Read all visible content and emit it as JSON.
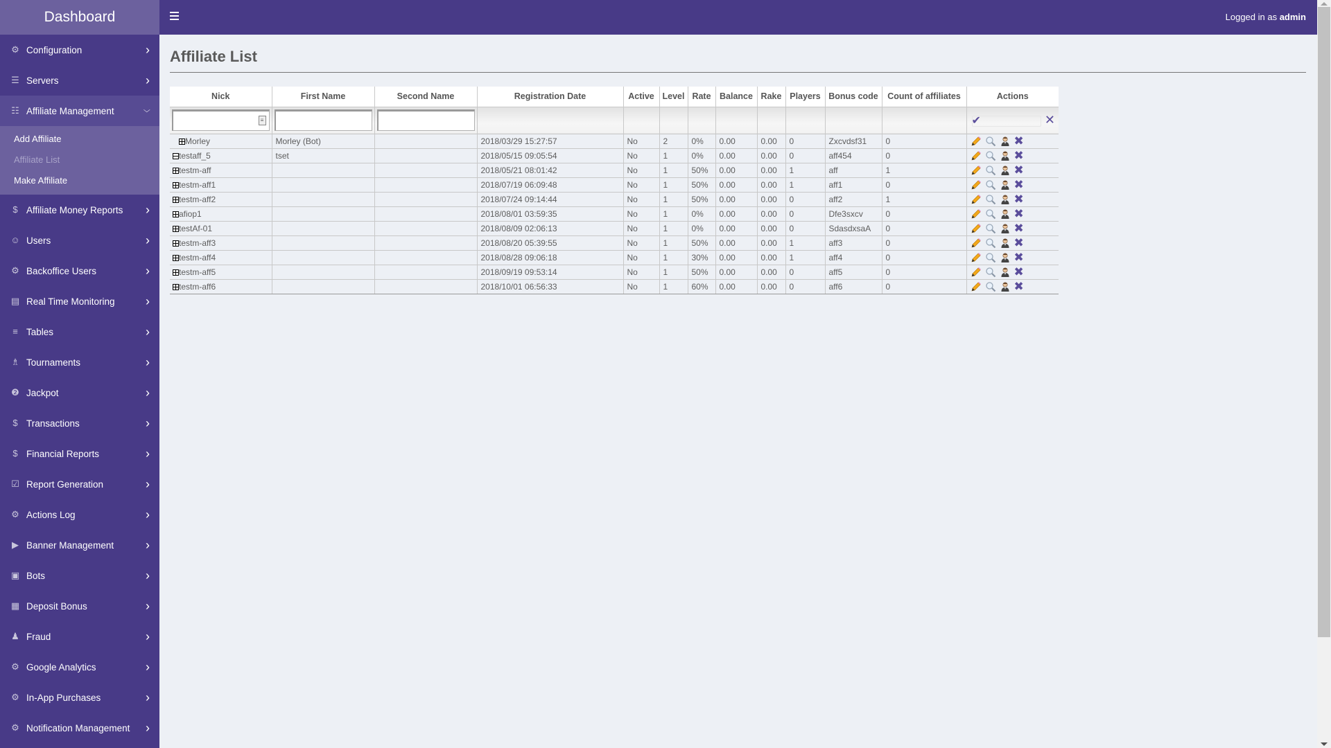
{
  "sidebar": {
    "brand": "Dashboard",
    "items": [
      {
        "label": "Configuration",
        "icon": "gear-icon"
      },
      {
        "label": "Servers",
        "icon": "server-icon"
      },
      {
        "label": "Affiliate Management",
        "icon": "affiliate-icon",
        "open": true,
        "children": [
          {
            "label": "Add Affiliate"
          },
          {
            "label": "Affiliate List",
            "active": true
          },
          {
            "label": "Make Affiliate"
          }
        ]
      },
      {
        "label": "Affiliate Money Reports",
        "icon": "money-report-icon"
      },
      {
        "label": "Users",
        "icon": "users-icon"
      },
      {
        "label": "Backoffice Users",
        "icon": "gear-icon"
      },
      {
        "label": "Real Time Monitoring",
        "icon": "monitor-icon"
      },
      {
        "label": "Tables",
        "icon": "tables-icon"
      },
      {
        "label": "Tournaments",
        "icon": "trophy-icon"
      },
      {
        "label": "Jackpot",
        "icon": "jackpot-icon"
      },
      {
        "label": "Transactions",
        "icon": "money-bag-icon"
      },
      {
        "label": "Financial Reports",
        "icon": "money-report-icon"
      },
      {
        "label": "Report Generation",
        "icon": "report-icon"
      },
      {
        "label": "Actions Log",
        "icon": "gear-icon"
      },
      {
        "label": "Banner Management",
        "icon": "megaphone-icon"
      },
      {
        "label": "Bots",
        "icon": "robot-icon"
      },
      {
        "label": "Deposit Bonus",
        "icon": "gift-icon"
      },
      {
        "label": "Fraud",
        "icon": "fraud-icon"
      },
      {
        "label": "Google Analytics",
        "icon": "gear-icon"
      },
      {
        "label": "In-App Purchases",
        "icon": "gear-icon"
      },
      {
        "label": "Notification Management",
        "icon": "gear-icon"
      }
    ]
  },
  "topbar": {
    "logged_prefix": "Logged in as ",
    "username": "admin"
  },
  "page": {
    "title": "Affiliate List"
  },
  "table": {
    "columns": [
      "Nick",
      "First Name",
      "Second Name",
      "Registration Date",
      "Active",
      "Level",
      "Rate",
      "Balance",
      "Rake",
      "Players",
      "Bonus code",
      "Count of affiliates",
      "Actions"
    ],
    "filters": {
      "nick": "",
      "first_name": "",
      "second_name": ""
    },
    "rows": [
      {
        "nick": "Morley",
        "expand": "plus",
        "indent": true,
        "first_name": "Morley (Bot)",
        "second_name": "",
        "registration_date": "2018/03/29 15:27:57",
        "active": "No",
        "level": "2",
        "rate": "0%",
        "balance": "0.00",
        "rake": "0.00",
        "players": "0",
        "bonus_code": "Zxcvdsf31",
        "count_of_affiliates": "0"
      },
      {
        "nick": "testaff_5",
        "expand": "minus",
        "first_name": "tset",
        "second_name": "",
        "registration_date": "2018/05/15 09:05:54",
        "active": "No",
        "level": "1",
        "rate": "0%",
        "balance": "0.00",
        "rake": "0.00",
        "players": "0",
        "bonus_code": "aff454",
        "count_of_affiliates": "0"
      },
      {
        "nick": "testm-aff",
        "expand": "plus",
        "first_name": "",
        "second_name": "",
        "registration_date": "2018/05/21 08:01:42",
        "active": "No",
        "level": "1",
        "rate": "50%",
        "balance": "0.00",
        "rake": "0.00",
        "players": "1",
        "bonus_code": "aff",
        "count_of_affiliates": "1"
      },
      {
        "nick": "testm-aff1",
        "expand": "plus",
        "first_name": "",
        "second_name": "",
        "registration_date": "2018/07/19 06:09:48",
        "active": "No",
        "level": "1",
        "rate": "50%",
        "balance": "0.00",
        "rake": "0.00",
        "players": "1",
        "bonus_code": "aff1",
        "count_of_affiliates": "0"
      },
      {
        "nick": "testm-aff2",
        "expand": "plus",
        "first_name": "",
        "second_name": "",
        "registration_date": "2018/07/24 09:14:44",
        "active": "No",
        "level": "1",
        "rate": "50%",
        "balance": "0.00",
        "rake": "0.00",
        "players": "0",
        "bonus_code": "aff2",
        "count_of_affiliates": "1"
      },
      {
        "nick": "afiop1",
        "expand": "plus",
        "first_name": "",
        "second_name": "",
        "registration_date": "2018/08/01 03:59:35",
        "active": "No",
        "level": "1",
        "rate": "0%",
        "balance": "0.00",
        "rake": "0.00",
        "players": "0",
        "bonus_code": "Dfe3sxcv",
        "count_of_affiliates": "0"
      },
      {
        "nick": "testAf-01",
        "expand": "plus",
        "first_name": "",
        "second_name": "",
        "registration_date": "2018/08/09 02:06:13",
        "active": "No",
        "level": "1",
        "rate": "0%",
        "balance": "0.00",
        "rake": "0.00",
        "players": "0",
        "bonus_code": "SdasdxsaA",
        "count_of_affiliates": "0"
      },
      {
        "nick": "testm-aff3",
        "expand": "plus",
        "first_name": "",
        "second_name": "",
        "registration_date": "2018/08/20 05:39:55",
        "active": "No",
        "level": "1",
        "rate": "50%",
        "balance": "0.00",
        "rake": "0.00",
        "players": "1",
        "bonus_code": "aff3",
        "count_of_affiliates": "0"
      },
      {
        "nick": "testm-aff4",
        "expand": "plus",
        "first_name": "",
        "second_name": "",
        "registration_date": "2018/08/28 09:06:18",
        "active": "No",
        "level": "1",
        "rate": "30%",
        "balance": "0.00",
        "rake": "0.00",
        "players": "1",
        "bonus_code": "aff4",
        "count_of_affiliates": "0"
      },
      {
        "nick": "testm-aff5",
        "expand": "plus",
        "first_name": "",
        "second_name": "",
        "registration_date": "2018/09/19 09:53:14",
        "active": "No",
        "level": "1",
        "rate": "50%",
        "balance": "0.00",
        "rake": "0.00",
        "players": "0",
        "bonus_code": "aff5",
        "count_of_affiliates": "0"
      },
      {
        "nick": "testm-aff6",
        "expand": "plus",
        "first_name": "",
        "second_name": "",
        "registration_date": "2018/10/01 06:56:33",
        "active": "No",
        "level": "1",
        "rate": "60%",
        "balance": "0.00",
        "rake": "0.00",
        "players": "0",
        "bonus_code": "aff6",
        "count_of_affiliates": "0"
      }
    ],
    "row_actions": [
      "edit-icon",
      "view-icon",
      "user-icon",
      "delete-icon"
    ]
  },
  "colors": {
    "sidebar_bg": "#483a87",
    "brand_bg": "#6c619e",
    "accent": "#5a4d9b",
    "content_bg": "#edf0f5"
  }
}
